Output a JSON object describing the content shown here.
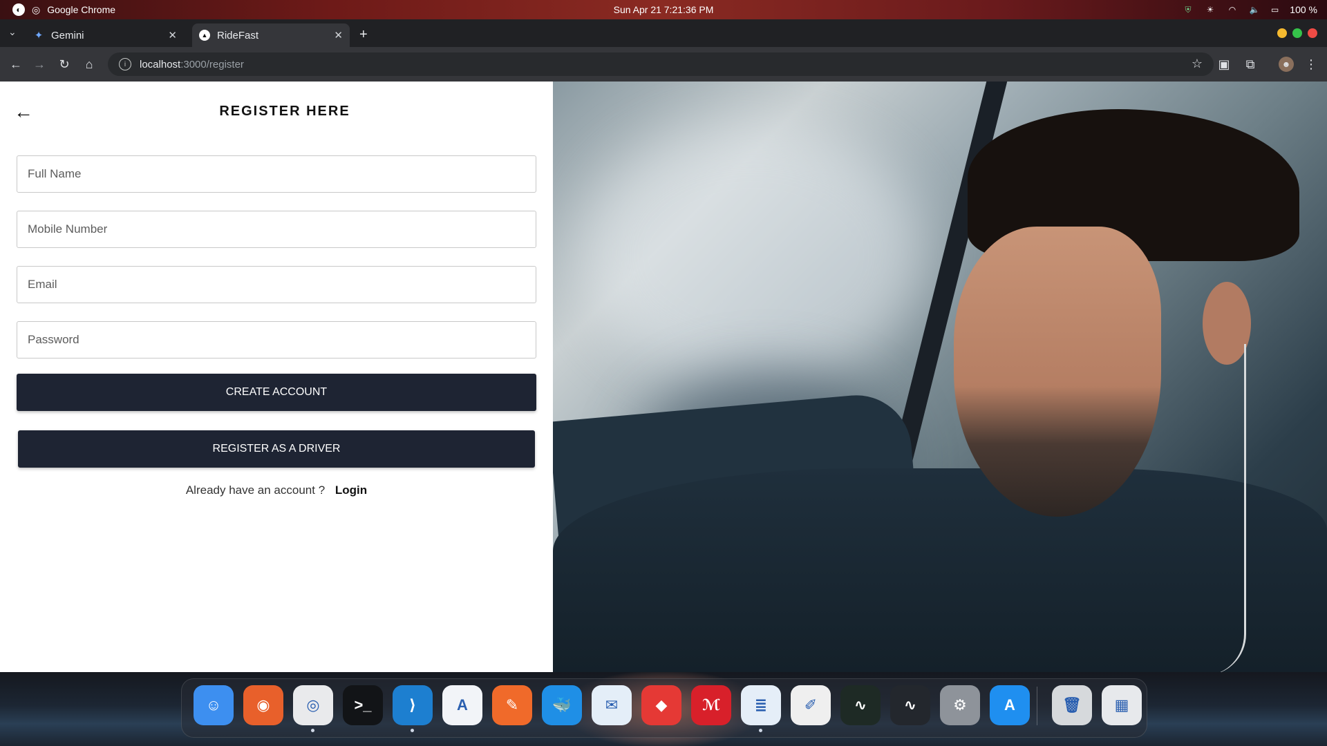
{
  "os_bar": {
    "app_name": "Google Chrome",
    "datetime": "Sun Apr 21   7:21:36 PM",
    "battery": "100 %"
  },
  "browser": {
    "tabs": [
      {
        "title": "Gemini",
        "favicon": "gemini-sparkle-icon",
        "active": false
      },
      {
        "title": "RideFast",
        "favicon": "ridefast-triangle-icon",
        "active": true
      }
    ],
    "url_host": "localhost",
    "url_path": ":3000/register"
  },
  "page": {
    "title": "REGISTER HERE",
    "fields": {
      "full_name": {
        "placeholder": "Full Name",
        "value": ""
      },
      "mobile": {
        "placeholder": "Mobile Number",
        "value": ""
      },
      "email": {
        "placeholder": "Email",
        "value": ""
      },
      "password": {
        "placeholder": "Password",
        "value": ""
      }
    },
    "create_account_label": "CREATE ACCOUNT",
    "register_driver_label": "REGISTER AS A DRIVER",
    "login_prompt": "Already have an account ?",
    "login_link": "Login"
  },
  "dock": {
    "items": [
      {
        "name": "finder",
        "glyph": "☺",
        "color": "#3d8ff0",
        "running": false
      },
      {
        "name": "firefox",
        "glyph": "◉",
        "color": "#e8602b",
        "running": false
      },
      {
        "name": "chrome",
        "glyph": "◎",
        "color": "#e9eaec",
        "running": true
      },
      {
        "name": "terminal",
        "glyph": ">_",
        "color": "#121417",
        "running": false
      },
      {
        "name": "vscode",
        "glyph": "⟩",
        "color": "#1d7fd0",
        "running": true
      },
      {
        "name": "app-launcher",
        "glyph": "A",
        "color": "#f2f4f8",
        "running": false
      },
      {
        "name": "postman",
        "glyph": "✎",
        "color": "#f06a2a",
        "running": false
      },
      {
        "name": "docker",
        "glyph": "🐳",
        "color": "#1f8fe6",
        "running": false
      },
      {
        "name": "thunderbird",
        "glyph": "✉",
        "color": "#e4eef8",
        "running": false
      },
      {
        "name": "anydesk",
        "glyph": "◆",
        "color": "#e53935",
        "running": false
      },
      {
        "name": "acrobat",
        "glyph": "ℳ",
        "color": "#d8202a",
        "running": false
      },
      {
        "name": "text-editor",
        "glyph": "≣",
        "color": "#e5eef8",
        "running": true
      },
      {
        "name": "notes",
        "glyph": "✐",
        "color": "#efefef",
        "running": false
      },
      {
        "name": "activity-monitor",
        "glyph": "∿",
        "color": "#1e2a25",
        "running": false
      },
      {
        "name": "system-monitor",
        "glyph": "∿",
        "color": "#23272d",
        "running": false
      },
      {
        "name": "settings",
        "glyph": "⚙",
        "color": "#8e939a",
        "running": false
      },
      {
        "name": "app-store",
        "glyph": "A",
        "color": "#1f8ff0",
        "running": false
      },
      {
        "name": "trash",
        "glyph": "🗑",
        "color": "#d6d9dc",
        "running": false
      },
      {
        "name": "app-grid",
        "glyph": "▦",
        "color": "#e7e9ec",
        "running": false
      }
    ]
  }
}
